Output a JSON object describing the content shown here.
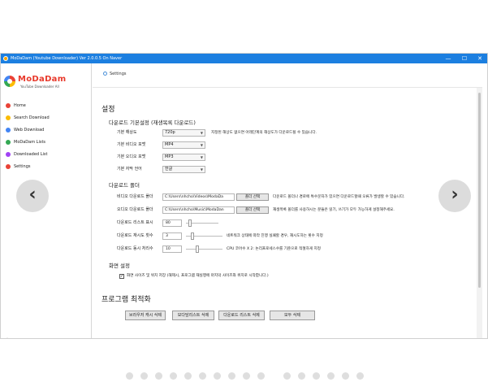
{
  "window": {
    "title": "MoDaDam (Youtube Downloader) Ver 2.0.0.5 On Naver",
    "controls": {
      "minimize": "—",
      "maximize": "☐",
      "close": "✕"
    }
  },
  "logo": {
    "name": "MoDaDam",
    "tagline": "YouTube Downloader All"
  },
  "sidebar": {
    "items": [
      {
        "label": "Home",
        "icon": "home-icon",
        "color": "#e94236"
      },
      {
        "label": "Search Download",
        "icon": "search-icon",
        "color": "#fbbc05"
      },
      {
        "label": "Web Download",
        "icon": "globe-icon",
        "color": "#4285f4"
      },
      {
        "label": "MoDaDam Lists",
        "icon": "list-icon",
        "color": "#34a853"
      },
      {
        "label": "Downloaded List",
        "icon": "folder-icon",
        "color": "#a142f4"
      },
      {
        "label": "Settings",
        "icon": "gear-icon",
        "color": "#e94236"
      }
    ],
    "back": "←"
  },
  "breadcrumb": {
    "label": "Settings"
  },
  "settings": {
    "title": "설정",
    "basic": {
      "heading": "다운로드 기본설정 (재생목록 다운로드)",
      "rows": [
        {
          "label": "기본 해상도",
          "value": "720p",
          "note": "지정된 해상도 없으면 아래단계의 해상도가 다운로드될 수 있습니다."
        },
        {
          "label": "기본 비디오 포맷",
          "value": "MP4"
        },
        {
          "label": "기본 오디오 포맷",
          "value": "MP3"
        },
        {
          "label": "기본 자막 언어",
          "value": "한글"
        }
      ]
    },
    "folder": {
      "heading": "다운로드 폴더",
      "video": {
        "label": "비디오 다운로드 폴더",
        "path": "C:\\Users\\nhcho\\Videos\\ModaDa",
        "button": "폴더 선택",
        "note": "다운로드 폴더나 경로에 특수문자가 있으면 다운로드할때 오류가 발생할 수 있습니다."
      },
      "audio": {
        "label": "오디오 다운로드 폴더",
        "path": "C:\\Users\\nhcho\\Music\\ModaDan",
        "button": "폴더 선택",
        "note": "재생목록 폴더를 사용하시는 분들은 읽기, 쓰기가 모두 가능하게 설정해주세요."
      }
    },
    "options": [
      {
        "label": "다운로드 리스트 표시",
        "value": "80",
        "slider": 0.08,
        "note": ""
      },
      {
        "label": "다운로드 재시도 횟수",
        "value": "3",
        "slider": 0.15,
        "note": "네트워크 상태에 따라 진행 실패할 경우, 재시도하는 횟수 지정"
      },
      {
        "label": "다운로드 동시 처리수",
        "value": "10",
        "slider": 0.3,
        "note": "CPU 코어수 X 2: 논리프로세스수를 기준으로 적절하게 지정"
      }
    ],
    "screen": {
      "heading": "화면 설정",
      "checkbox_label": "화면 사이즈 및 위치 저장 (해제시, 프로그램 재실행에 마지막 사이즈와 위치로 시작합니다.)",
      "checked": true
    },
    "optimize": {
      "heading": "프로그램 최적화",
      "buttons": [
        "브라우저 캐시 삭제",
        "모다담리스트 삭제",
        "다운로드 리스트 삭제",
        "모두 삭제"
      ]
    }
  },
  "gallery": {
    "prev": "‹",
    "next": "›"
  }
}
